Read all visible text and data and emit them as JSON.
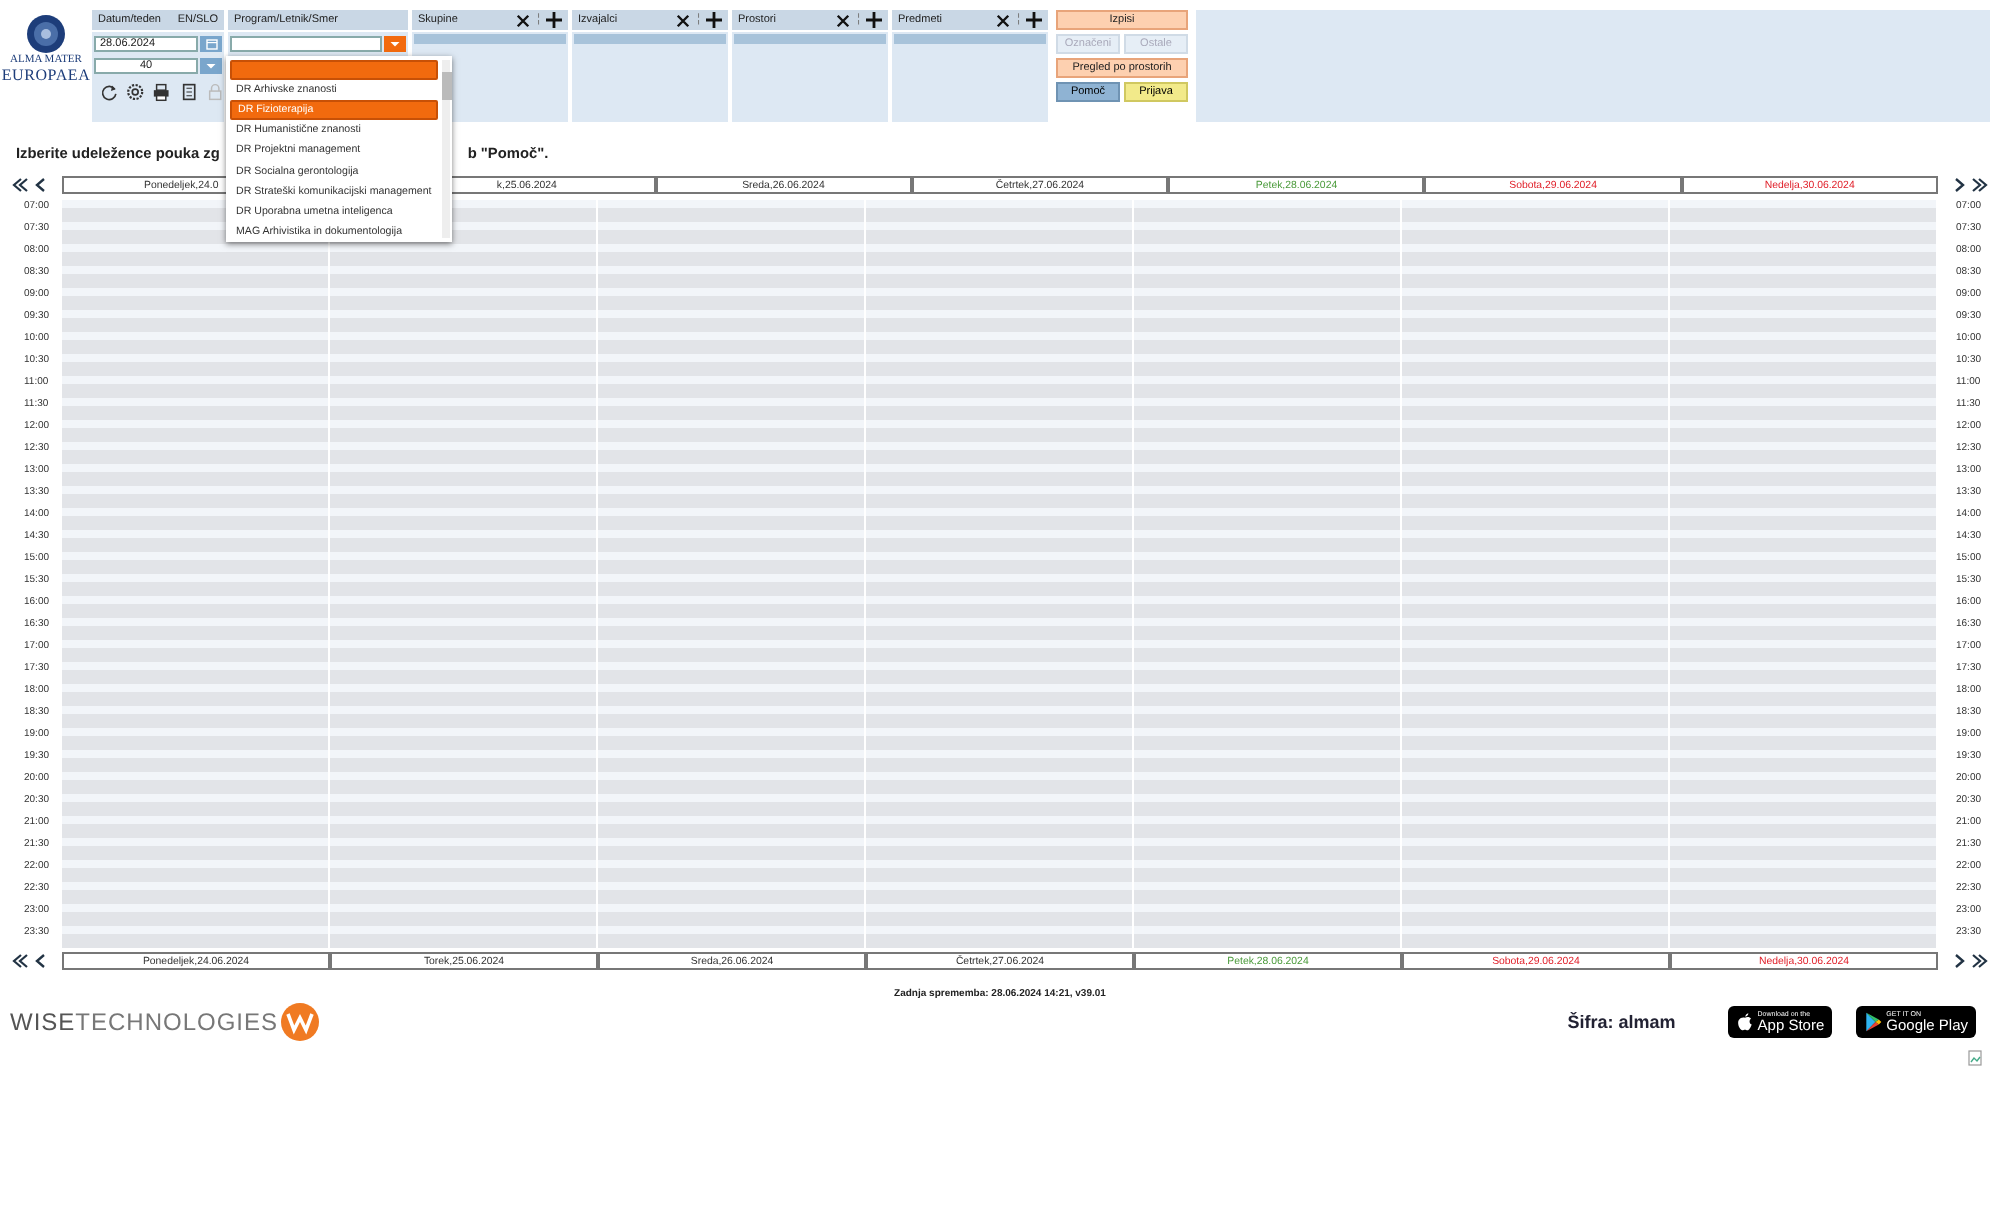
{
  "logo": {
    "line1": "ALMA MATER",
    "line2": "EUROPAEA"
  },
  "date_panel": {
    "title": "Datum/teden",
    "language_link": "EN/SLO",
    "date": "28.06.2024",
    "week": "40"
  },
  "toolbar_icons": [
    {
      "kind": "refresh",
      "disabled": false
    },
    {
      "kind": "settings",
      "disabled": false
    },
    {
      "kind": "print",
      "disabled": false
    },
    {
      "kind": "document",
      "disabled": false
    },
    {
      "kind": "lock",
      "disabled": true
    }
  ],
  "program_panel": {
    "title": "Program/Letnik/Smer",
    "dropdown": {
      "expanded": true,
      "items": [
        {
          "highlighted": true
        },
        {
          "label": "DR Arhivske znanosti",
          "highlighted": false
        },
        {
          "label": "DR Fizioterapija",
          "highlighted": true
        },
        {
          "label": "DR Humanistične znanosti",
          "highlighted": false
        },
        {
          "label": "DR Projektni management",
          "highlighted": false
        },
        {
          "label": "DR Socialna gerontologija",
          "highlighted": false
        },
        {
          "label": "DR Strateški komunikacijski management",
          "highlighted": false
        },
        {
          "label": "DR Uporabna umetna inteligenca",
          "highlighted": false
        },
        {
          "label": "MAG Arhivistika in dokumentologija",
          "highlighted": false
        }
      ]
    }
  },
  "filters": [
    {
      "title": "Skupine",
      "separator": "¦"
    },
    {
      "title": "Izvajalci",
      "separator": "¦"
    },
    {
      "title": "Prostori",
      "separator": "¦"
    },
    {
      "title": "Predmeti",
      "separator": "¦"
    }
  ],
  "buttons": [
    {
      "label": "Izpisi",
      "kind": "primary",
      "disabled": false
    },
    {
      "label": "Označeni",
      "kind": "plain",
      "disabled": true
    },
    {
      "label": "Ostale",
      "kind": "plain",
      "disabled": true
    },
    {
      "label": "Pregled po prostorih",
      "kind": "primary",
      "disabled": false
    },
    {
      "label": "Pomoč",
      "kind": "help",
      "disabled": false
    },
    {
      "label": "Prijava",
      "kind": "login",
      "disabled": false
    }
  ],
  "instruction": {
    "before": "Izberite udeležence pouka zg",
    "after": "b \"Pomoč\"."
  },
  "top_days": [
    {
      "label": "Ponedeljek,24.0",
      "kind": "weekday"
    },
    {
      "label": "k,25.06.2024",
      "kind": "weekday"
    },
    {
      "label": "Sreda,26.06.2024",
      "kind": "weekday"
    },
    {
      "label": "Četrtek,27.06.2024",
      "kind": "weekday"
    },
    {
      "label": "Petek,28.06.2024",
      "kind": "today"
    },
    {
      "label": "Sobota,29.06.2024",
      "kind": "weekend"
    },
    {
      "label": "Nedelja,30.06.2024",
      "kind": "weekend"
    }
  ],
  "bottom_days": [
    {
      "label": "Ponedeljek,24.06.2024",
      "kind": "weekday"
    },
    {
      "label": "Torek,25.06.2024",
      "kind": "weekday"
    },
    {
      "label": "Sreda,26.06.2024",
      "kind": "weekday"
    },
    {
      "label": "Četrtek,27.06.2024",
      "kind": "weekday"
    },
    {
      "label": "Petek,28.06.2024",
      "kind": "today"
    },
    {
      "label": "Sobota,29.06.2024",
      "kind": "weekend"
    },
    {
      "label": "Nedelja,30.06.2024",
      "kind": "weekend"
    }
  ],
  "times_right": [
    "07:00",
    "07:30",
    "08:00",
    "08:30",
    "09:00",
    "09:30",
    "10:00",
    "10:30",
    "11:00",
    "11:30",
    "12:00",
    "12:30",
    "13:00",
    "13:30",
    "14:00",
    "14:30",
    "15:00",
    "15:30",
    "16:00",
    "16:30",
    "17:00",
    "17:30",
    "18:00",
    "18:30",
    "19:00",
    "19:30",
    "20:00",
    "20:30",
    "21:00",
    "21:30",
    "22:00",
    "22:30",
    "23:00",
    "23:30"
  ],
  "times_left": [
    "07:00",
    "07:30",
    "08:00",
    "08:30",
    "09:00",
    "09:30",
    "10:00",
    "10:30",
    "11:00",
    "11:30",
    "12:00",
    "12:30",
    "13:00",
    "13:30",
    "14:00",
    "14:30",
    "15:00",
    "15:30",
    "16:00",
    "16:30",
    "17:00",
    "17:30",
    "18:00",
    "18:30",
    "19:00",
    "19:30",
    "20:00",
    "20:30",
    "21:00",
    "21:30",
    "22:00",
    "22:30",
    "23:00",
    "23:30"
  ],
  "last_change": "Zadnja sprememba: 28.06.2024 14:21, v39.01",
  "vendor_logo": {
    "strong": "WISE",
    "light": "TECHNOLOGIES"
  },
  "code": "Šifra: almam",
  "store_badges": [
    {
      "kind": "apple",
      "small": "Download on the",
      "big": "App Store"
    },
    {
      "kind": "google",
      "small": "GET IT ON",
      "big": "Google Play"
    }
  ]
}
